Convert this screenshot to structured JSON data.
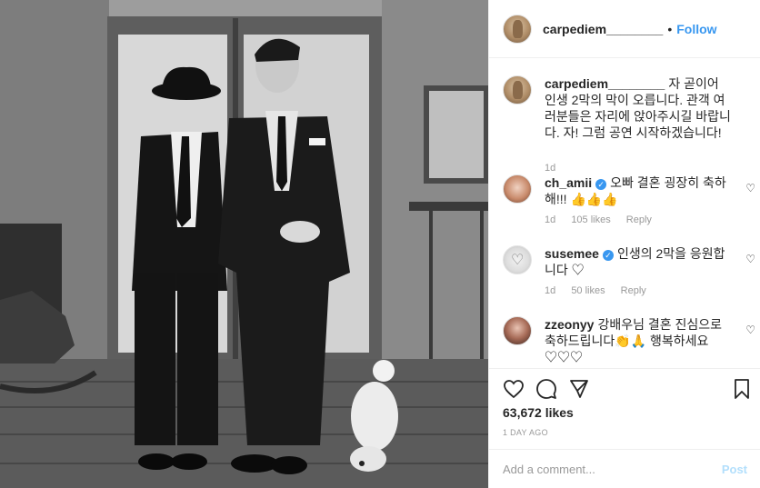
{
  "post": {
    "username": "carpediem________",
    "separator": "•",
    "follow_label": "Follow"
  },
  "caption": {
    "username": "carpediem________",
    "text": "자 곧이어 인생 2막의 막이 오릅니다. 관객 여러분들은 자리에 앉아주시길 바랍니다. 자! 그럼 공연 시작하겠습니다!",
    "time": "1d"
  },
  "comments": [
    {
      "username": "ch_amii",
      "verified": true,
      "text": "오빠 결혼 굉장히 축하해!!! 👍👍👍",
      "time": "1d",
      "likes": "105 likes",
      "reply": "Reply"
    },
    {
      "username": "susemee",
      "verified": true,
      "text": "인생의 2막을 응원합니다 ♡",
      "time": "1d",
      "likes": "50 likes",
      "reply": "Reply"
    },
    {
      "username": "zzeonyy",
      "verified": false,
      "text": "강배우님 결혼 진심으로 축하드립니다👏🙏 행복하세요 ♡♡♡"
    }
  ],
  "actions": {
    "likes_count": "63,672 likes",
    "time_ago": "1 DAY AGO"
  },
  "add_comment": {
    "placeholder": "Add a comment...",
    "post_label": "Post"
  },
  "icons": {
    "like": "heart-icon",
    "comment": "comment-bubble-icon",
    "share": "paper-plane-icon",
    "save": "bookmark-icon",
    "comment_like": "small-heart-icon"
  },
  "colors": {
    "accent": "#3897f0",
    "post_disabled": "#b2dffc",
    "muted": "#999999",
    "text": "#262626"
  }
}
